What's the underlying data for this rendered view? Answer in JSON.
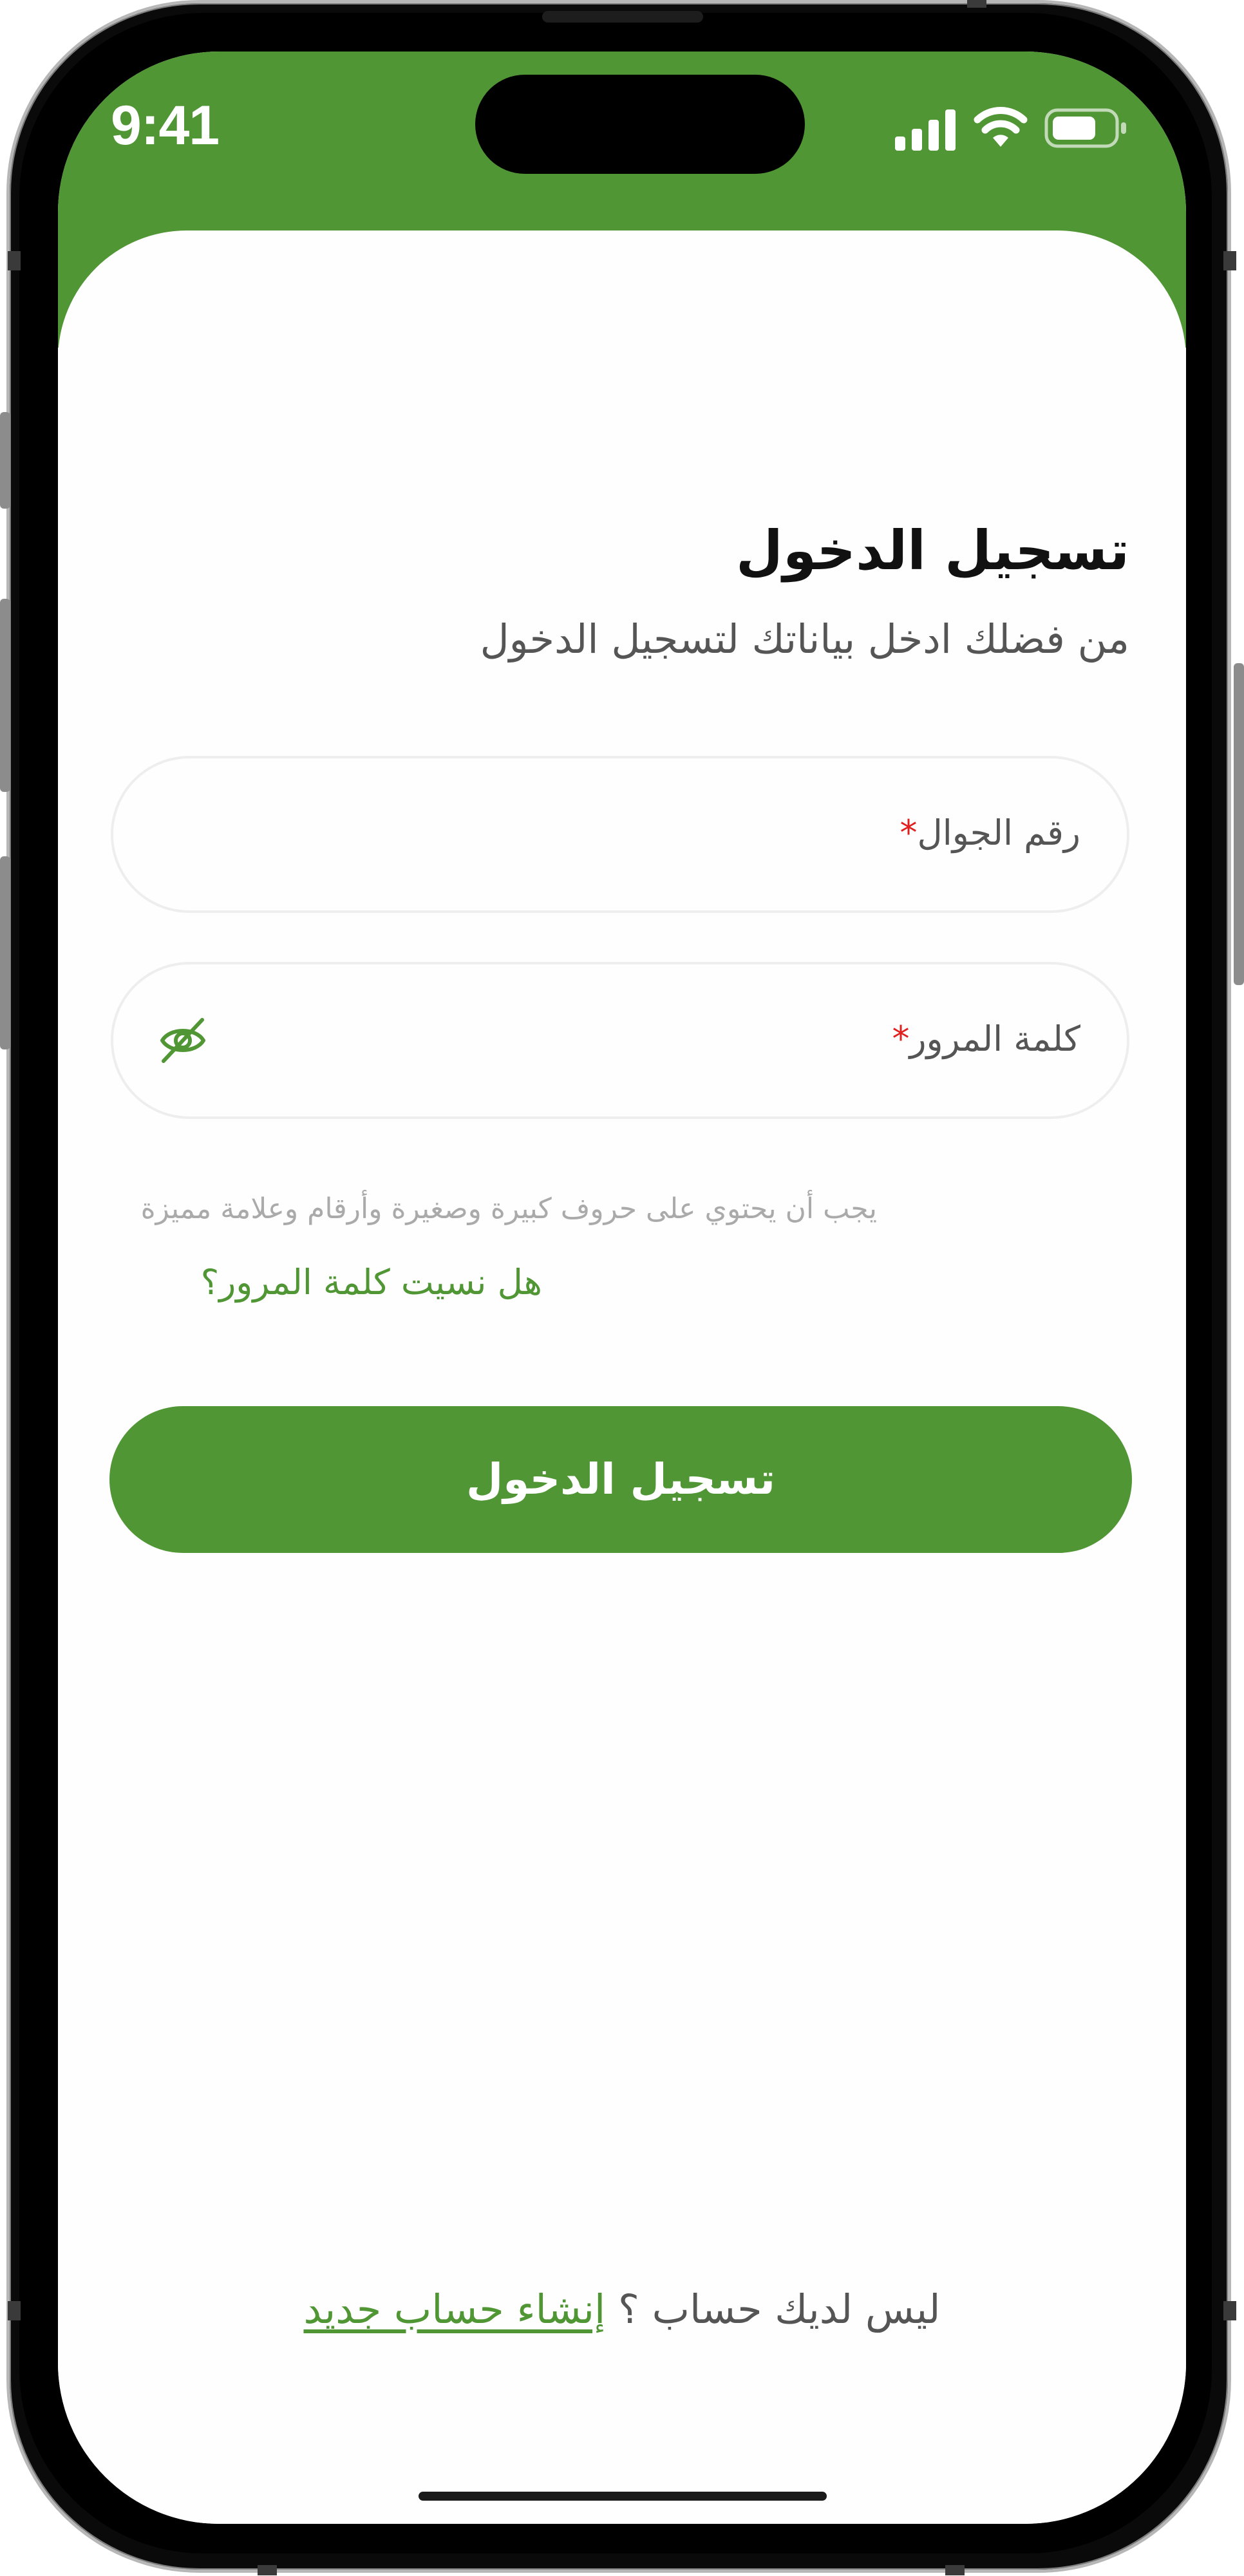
{
  "status_bar": {
    "time": "9:41"
  },
  "login": {
    "title": "تسجيل الدخول",
    "subtitle": "من فضلك ادخل بياناتك لتسجيل الدخول",
    "phone_field": {
      "label": "رقم الجوال",
      "required_mark": "*",
      "value": ""
    },
    "password_field": {
      "label": "كلمة المرور",
      "required_mark": "*",
      "value": ""
    },
    "password_hint": "يجب أن يحتوي على حروف كبيرة وصغيرة وأرقام وعلامة مميزة",
    "forgot_password": "هل نسيت كلمة المرور؟",
    "submit_label": "تسجيل الدخول",
    "no_account_text": "ليس لديك حساب ؟",
    "create_account_link": "إنشاء حساب جديد"
  },
  "icons": {
    "password_toggle": "eye-off-icon",
    "signal": "cellular-signal-icon",
    "wifi": "wifi-icon",
    "battery": "battery-icon"
  },
  "colors": {
    "brand_green": "#509634",
    "required_red": "#e0201f",
    "text_dark": "#111111",
    "text_muted": "#555555",
    "hint_gray": "#aaaaaa"
  }
}
